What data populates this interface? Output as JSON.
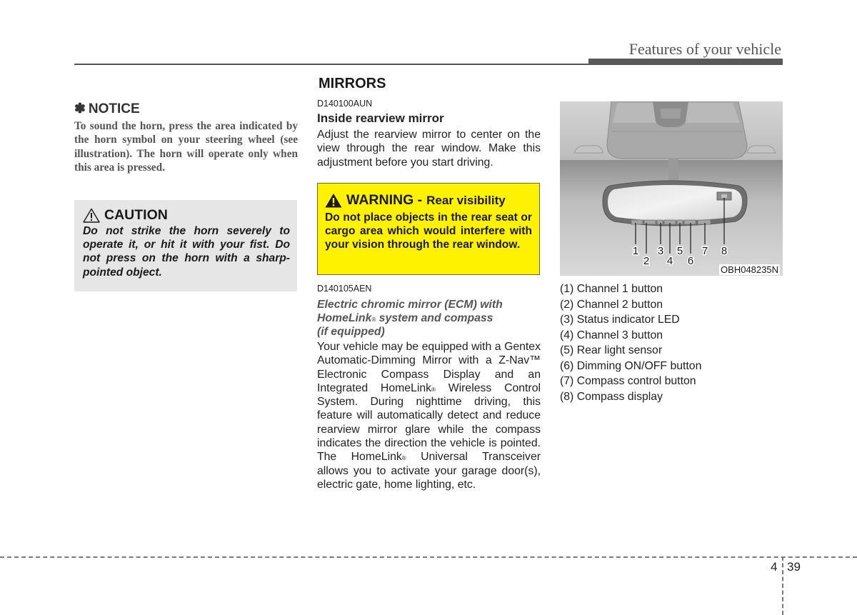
{
  "header": {
    "section_title": "Features of your vehicle"
  },
  "notice": {
    "symbol": "✽",
    "title": "NOTICE",
    "body": "To sound the horn, press the area indicated by the horn symbol on your steering wheel (see illustration). The horn will operate only when this area is pressed."
  },
  "caution": {
    "icon": "warning-triangle-outline",
    "title": "CAUTION",
    "body": "Do not strike the horn severely to operate it, or hit it with your fist. Do not press on the horn with a sharp-pointed object."
  },
  "mirrors": {
    "title": "MIRRORS",
    "inside": {
      "code": "D140100AUN",
      "title": "Inside rearview mirror",
      "body": "Adjust the rearview mirror to center on the view through the rear window. Make this adjustment before you start driving."
    },
    "warning": {
      "icon": "warning-triangle-filled",
      "title": "WARNING -",
      "subtitle": "Rear visibility",
      "body": "Do not place objects in the rear seat or cargo area which would interfere with your vision through the rear window.",
      "color": "#fff200"
    },
    "ecm": {
      "code": "D140105AEN",
      "title_1": "Electric chromic mirror (ECM) with",
      "title_2a": "HomeLink",
      "title_2b": " system and compass",
      "title_3": "(if equipped)",
      "registered": "®",
      "body_1": "Your vehicle may be equipped with a Gentex Automatic-Dimming Mirror with a Z-Nav™ Electronic Compass Display and an Integrated HomeLink",
      "body_2": " Wireless Control System. During nighttime driving, this feature will automatically detect and reduce rearview mirror glare while the compass indicates the direction the vehicle is pointed. The HomeLink",
      "body_3": " Universal Transceiver allows you to activate your garage door(s), electric gate, home lighting, etc."
    }
  },
  "figure": {
    "code": "OBH048235N",
    "callouts": [
      "1",
      "2",
      "3",
      "4",
      "5",
      "6",
      "7",
      "8"
    ]
  },
  "legend": {
    "items": [
      "(1) Channel 1 button",
      "(2) Channel 2 button",
      "(3) Status indicator LED",
      "(4) Channel 3 button",
      "(5) Rear light sensor",
      "(6) Dimming ON/OFF button",
      "(7) Compass control button",
      "(8) Compass display"
    ]
  },
  "footer": {
    "chapter": "4",
    "page": "39"
  }
}
